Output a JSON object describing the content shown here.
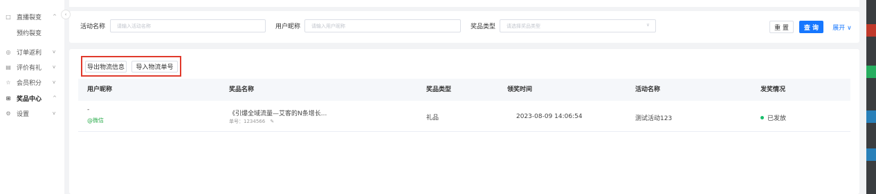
{
  "sidebar": {
    "collapse_icon": "chevron-left-icon",
    "items": [
      {
        "icon": "□",
        "label": "直播裂变",
        "chevron": "^",
        "kind": "parent"
      },
      {
        "icon": "",
        "label": "预约裂变",
        "chevron": "",
        "kind": "sub"
      },
      {
        "icon": "◎",
        "label": "订单返利",
        "chevron": "v",
        "kind": "parent"
      },
      {
        "icon": "▤",
        "label": "评价有礼",
        "chevron": "v",
        "kind": "parent"
      },
      {
        "icon": "☆",
        "label": "会员积分",
        "chevron": "v",
        "kind": "parent"
      },
      {
        "icon": "⊞",
        "label": "奖品中心",
        "chevron": "^",
        "kind": "active"
      },
      {
        "icon": "⚙",
        "label": "设置",
        "chevron": "v",
        "kind": "parent"
      }
    ]
  },
  "filters": {
    "activity_label": "活动名称",
    "activity_placeholder": "请输入活动名称",
    "nickname_label": "用户昵称",
    "nickname_placeholder": "请输入用户昵称",
    "prize_type_label": "奖品类型",
    "prize_type_placeholder": "请选择奖品类型",
    "reset": "重 置",
    "query": "查 询",
    "expand": "展开 ∨"
  },
  "actions": {
    "export": "导出物流信息",
    "import": "导入物流单号"
  },
  "table": {
    "headers": [
      "用户昵称",
      "奖品名称",
      "奖品类型",
      "领奖时间",
      "活动名称",
      "发奖情况"
    ],
    "rows": [
      {
        "nickname": "-",
        "channel": "@微信",
        "prize_name": "《引爆全域流量—艾客的N条增长...",
        "order_no": "单号：1234566",
        "prize_type": "礼品",
        "time": "2023-08-09 14:06:54",
        "activity": "测试活动123",
        "status": "已发放"
      }
    ]
  },
  "colors": {
    "primary": "#1677ff",
    "highlight_border": "#e0392b",
    "success": "#19be6b",
    "wechat": "#2fae4f"
  }
}
